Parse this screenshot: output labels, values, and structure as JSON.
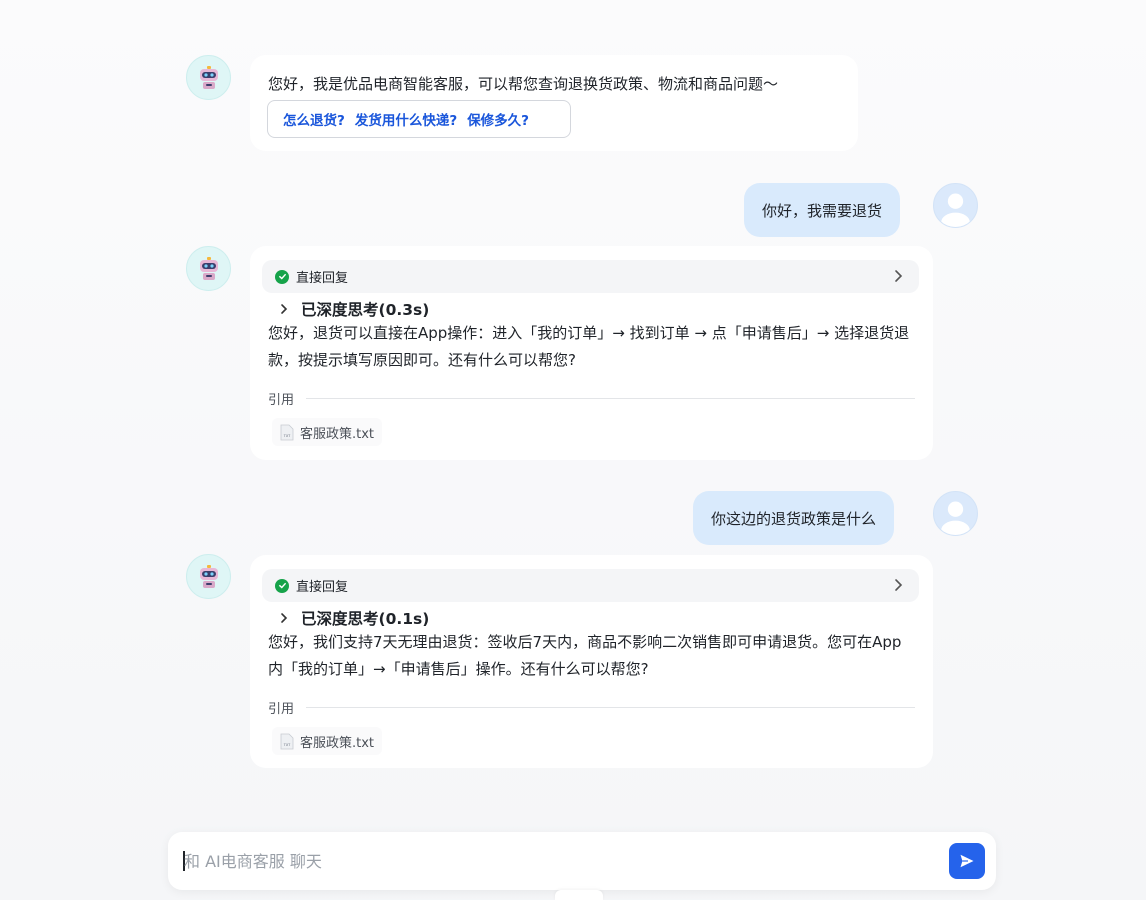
{
  "greeting": {
    "text": "您好，我是优品电商智能客服，可以帮您查询退换货政策、物流和商品问题～",
    "quick_questions": [
      "怎么退货?",
      "发货用什么快递?",
      "保修多久?"
    ]
  },
  "messages": [
    {
      "user_text": "你好，我需要退货",
      "status": "直接回复",
      "thinking": "已深度思考(0.3s)",
      "answer": "您好，退货可以直接在App操作：进入「我的订单」→ 找到订单 → 点「申请售后」→ 选择退货退款，按提示填写原因即可。还有什么可以帮您?",
      "citation_label": "引用",
      "file_icon_text": "TXT",
      "file_name": "客服政策.txt"
    },
    {
      "user_text": "你这边的退货政策是什么",
      "status": "直接回复",
      "thinking": "已深度思考(0.1s)",
      "answer": "您好，我们支持7天无理由退货：签收后7天内，商品不影响二次销售即可申请退货。您可在App内「我的订单」→「申请售后」操作。还有什么可以帮您?",
      "citation_label": "引用",
      "file_icon_text": "TXT",
      "file_name": "客服政策.txt"
    }
  ],
  "input": {
    "placeholder": "和 AI电商客服 聊天",
    "value": ""
  },
  "icons": {
    "bot_avatar": "robot-icon",
    "user_avatar": "user-icon",
    "status_check": "check-circle-icon",
    "expand": "chevron-right-icon",
    "file": "txt-file-icon",
    "send": "send-icon"
  },
  "colors": {
    "accent": "#2563eb",
    "link": "#1a56db",
    "user_bubble": "#d9eafc",
    "success": "#16a34a"
  }
}
